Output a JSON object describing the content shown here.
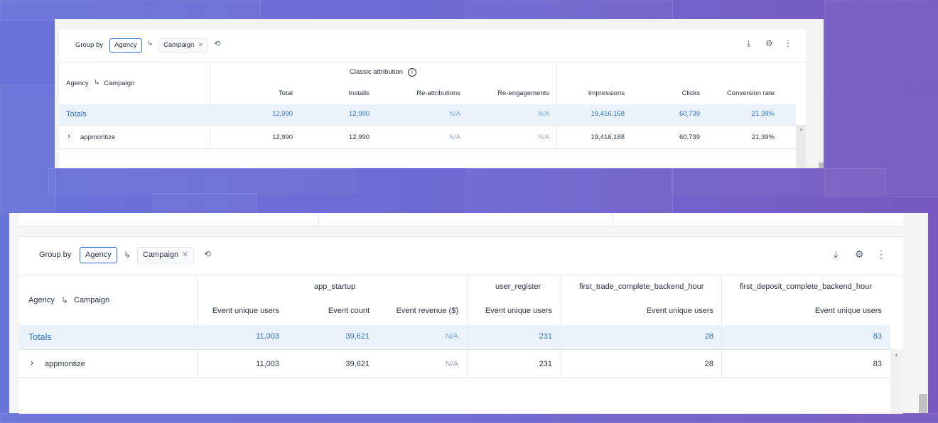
{
  "top": {
    "group_by_label": "Group by",
    "agency_chip": "Agency",
    "campaign_chip": "Campaign",
    "header_left": "Agency",
    "header_left_sub": "Campaign",
    "group_title": "Classic attribution",
    "columns": [
      "Total",
      "Installs",
      "Re-attributions",
      "Re-engagements",
      "Impressions",
      "Clicks",
      "Conversion rate"
    ],
    "totals": {
      "label": "Totals",
      "values": [
        "12,990",
        "12,990",
        "N/A",
        "N/A",
        "19,416,168",
        "60,739",
        "21.39%"
      ]
    },
    "row": {
      "label": "appmontize",
      "values": [
        "12,990",
        "12,990",
        "N/A",
        "N/A",
        "19,416,168",
        "60,739",
        "21.39%"
      ]
    }
  },
  "bottom": {
    "group_by_label": "Group by",
    "agency_chip": "Agency",
    "campaign_chip": "Campaign",
    "header_left": "Agency",
    "header_left_sub": "Campaign",
    "groups": [
      "app_startup",
      "user_register",
      "first_trade_complete_backend_hour",
      "first_deposit_complete_backend_hour"
    ],
    "columns": [
      "Event unique users",
      "Event count",
      "Event revenue ($)",
      "Event unique users",
      "Event unique users",
      "Event unique users"
    ],
    "totals": {
      "label": "Totals",
      "values": [
        "11,003",
        "39,621",
        "N/A",
        "231",
        "28",
        "83"
      ]
    },
    "row": {
      "label": "appmontize",
      "values": [
        "11,003",
        "39,621",
        "N/A",
        "231",
        "28",
        "83"
      ]
    }
  },
  "icons": {
    "download": "download-icon",
    "settings": "gear-icon",
    "more": "more-vertical-icon",
    "history": "history-icon",
    "subgroup": "subgroup-arrow-icon",
    "expand": "chevron-right-icon",
    "info": "info-icon"
  }
}
